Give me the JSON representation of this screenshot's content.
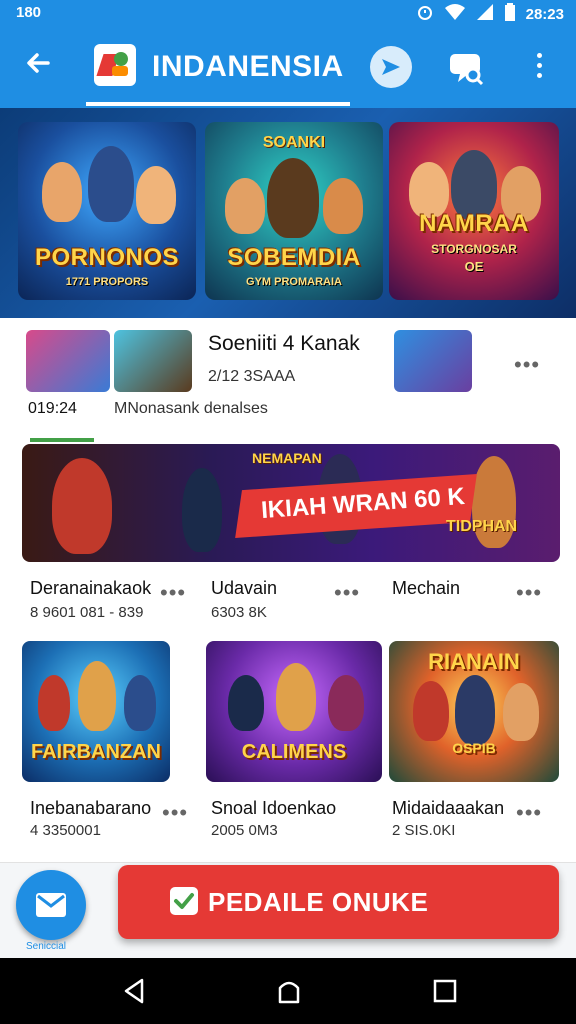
{
  "status_bar": {
    "left_time": "180",
    "clock": "28:23",
    "icons": [
      "alarm-icon",
      "wifi-icon",
      "signal-icon",
      "battery-icon"
    ]
  },
  "app_bar": {
    "title": "INDANENSIA",
    "back_icon": "arrow-left-icon",
    "actions": [
      "send-icon",
      "chat-icon",
      "more-vert-icon"
    ],
    "accent": "#1f8ee3"
  },
  "hero": {
    "cards": [
      {
        "caption": "PORNONOS",
        "subcaption": "1771 PROPORS"
      },
      {
        "top": "SOANKI",
        "caption": "SOBEMDIA",
        "subcaption": "GYM PROMARAIA"
      },
      {
        "caption": "NAMRAA",
        "subcaption": "STORGNOSAR",
        "extra": "OE"
      }
    ]
  },
  "featured_row": {
    "title": "Soeniiti 4 Kanak",
    "meta": "2/12 3SAAA",
    "time": "019:24",
    "description": "MNonasank denalses"
  },
  "banner": {
    "top_text": "NEMAPAN",
    "red_text": "IKIAH WRAN 60 K",
    "bottom_text": "TIDPHAN"
  },
  "row2": [
    {
      "title": "Deranainakaok",
      "sub": "8 9601 081 - 839"
    },
    {
      "title": "Udavain",
      "sub": "6303 8K"
    },
    {
      "title": "Mechain",
      "sub": ""
    }
  ],
  "grid": [
    {
      "caption": "FAIRBANZAN",
      "title": "Inebanabarano",
      "sub": "4 3350001"
    },
    {
      "caption": "CALIMENS",
      "title": "Snoal Idoenkao",
      "sub": "2005 0M3"
    },
    {
      "top": "RIANAIN",
      "caption": "OSPIB",
      "title": "Midaidaaakan",
      "sub": "2 SIS.0KI"
    }
  ],
  "fab": {
    "icon": "mail-icon",
    "label": "Seniccial"
  },
  "cta": {
    "label": "PEDAILE ONUKE",
    "icon": "check-icon"
  },
  "nav": {
    "icons": [
      "back-triangle-icon",
      "home-icon",
      "recents-square-icon"
    ]
  }
}
